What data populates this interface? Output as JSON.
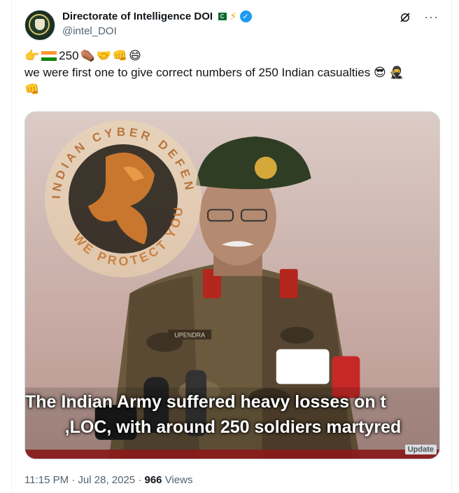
{
  "post": {
    "display_name": "Directorate of Intelligence DOI",
    "handle": "@intel_DOI",
    "emoji_line_number": "250",
    "text": "we were first one to give correct numbers of 250 Indian casualties",
    "timestamp": "11:15 PM · Jul 28, 2025",
    "views_count": "966",
    "views_label": "Views"
  },
  "media": {
    "subtitle_line1": "The Indian Army suffered heavy losses on t",
    "subtitle_line2": ",LOC, with around 250 soldiers martyred",
    "update_tag": "Update",
    "watermark_top": "INDIAN CYBER DEFENDER",
    "watermark_bottom": "WE PROTECT YOU",
    "name_tag": "UPENDRA"
  },
  "icons": {
    "verified": "verified-badge-icon",
    "flag": "pakistan-flag-icon",
    "bolt": "lightning-icon",
    "grok": "grok-icon",
    "more": "more-options-icon"
  },
  "colors": {
    "accent": "#1d9bf0",
    "text": "#0f1419",
    "muted": "#536471"
  }
}
